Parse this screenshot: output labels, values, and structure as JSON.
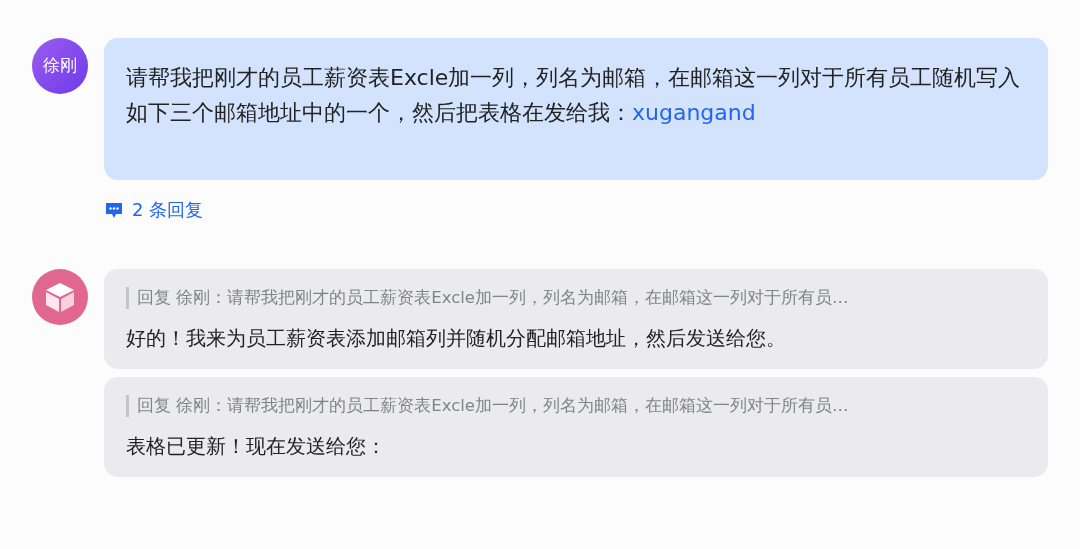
{
  "messages": [
    {
      "sender": {
        "name": "徐刚",
        "kind": "initials"
      },
      "kind": "user",
      "text": "请帮我把刚才的员工薪资表Excle加一列，列名为邮箱，在邮箱这一列对于所有员工随机写入如下三个邮箱地址中的一个，然后把表格在发给我：",
      "link": "xugangand",
      "replies": "2 条回复"
    },
    {
      "sender": {
        "kind": "bot"
      },
      "kind": "bot",
      "parts": [
        {
          "quote": "回复 徐刚：请帮我把刚才的员工薪资表Excle加一列，列名为邮箱，在邮箱这一列对于所有员…",
          "text": "好的！我来为员工薪资表添加邮箱列并随机分配邮箱地址，然后发送给您。"
        },
        {
          "quote": "回复 徐刚：请帮我把刚才的员工薪资表Excle加一列，列名为邮箱，在邮箱这一列对于所有员…",
          "text": "表格已更新！现在发送给您："
        }
      ]
    }
  ]
}
